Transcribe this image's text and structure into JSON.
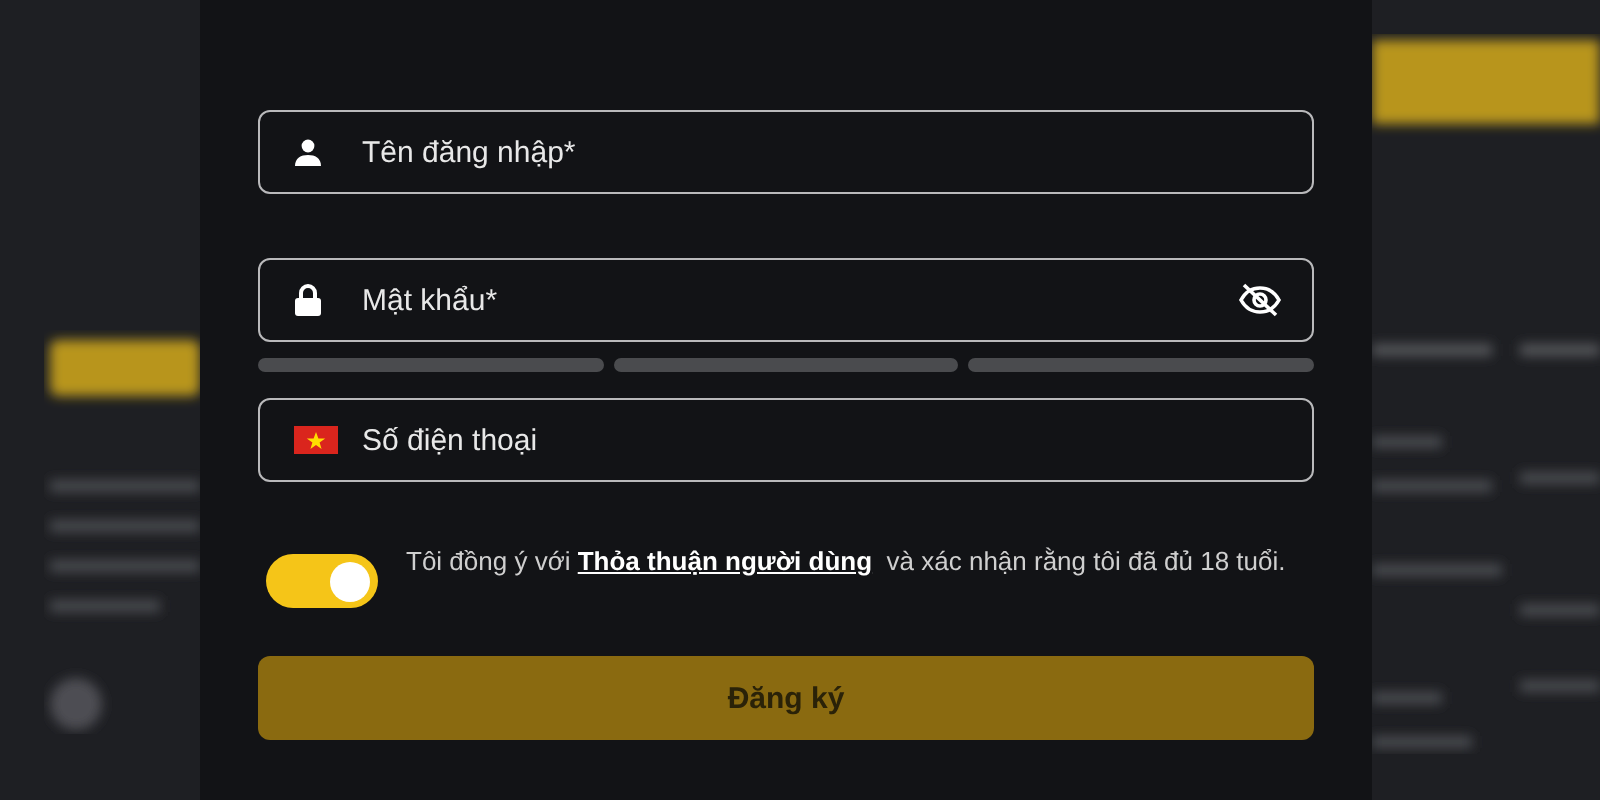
{
  "form": {
    "fields": [
      {
        "kind": "user",
        "placeholder": "Tên đăng nhập*"
      },
      {
        "kind": "password",
        "placeholder": "Mật khẩu*"
      },
      {
        "kind": "phone",
        "placeholder": "Số điện thoại"
      }
    ],
    "strength_bars": [
      {
        "filled": false
      },
      {
        "filled": false
      },
      {
        "filled": false
      }
    ],
    "agree_toggle": {
      "on": true
    },
    "terms": {
      "before": "Tôi đồng ý với",
      "link": "Thỏa thuận người dùng",
      "after": "và xác nhận rằng tôi đã đủ 18 tuổi."
    },
    "submit": {
      "label": "Đăng ký",
      "disabled": true
    }
  }
}
